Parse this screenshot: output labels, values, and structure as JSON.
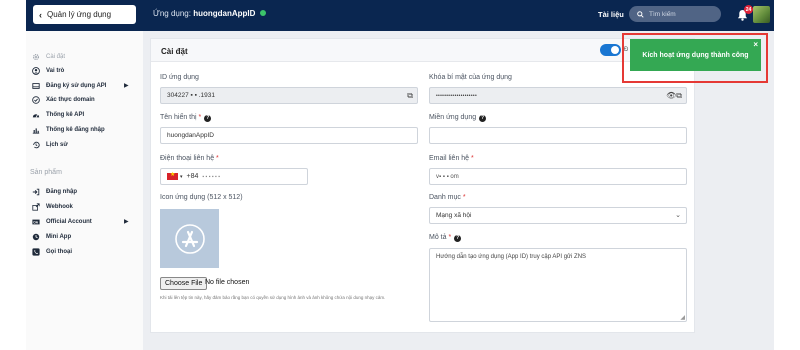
{
  "topbar": {
    "back_label": "Quản lý ứng dụng",
    "app_prefix": "Ứng dụng:",
    "app_name": "huongdanAppID",
    "docs_label": "Tài liệu",
    "search_placeholder": "Tìm kiếm",
    "notification_count": "24"
  },
  "sidebar": {
    "items": [
      {
        "label": "Cài đặt",
        "icon": "gear-icon"
      },
      {
        "label": "Vai trò",
        "icon": "user-circle-icon"
      },
      {
        "label": "Đăng ký sử dụng API",
        "icon": "window-icon"
      },
      {
        "label": "Xác thực domain",
        "icon": "check-circle-icon"
      },
      {
        "label": "Thống kê API",
        "icon": "gauge-icon"
      },
      {
        "label": "Thống kê đăng nhập",
        "icon": "bar-chart-icon"
      },
      {
        "label": "Lịch sử",
        "icon": "history-icon"
      }
    ],
    "section_products": "Sản phẩm",
    "products": [
      {
        "label": "Đăng nhập",
        "icon": "login-icon"
      },
      {
        "label": "Webhook",
        "icon": "external-link-icon"
      },
      {
        "label": "Official Account",
        "icon": "oa-icon"
      },
      {
        "label": "Mini App",
        "icon": "mini-app-icon"
      },
      {
        "label": "Gọi thoại",
        "icon": "phone-icon"
      }
    ]
  },
  "settings": {
    "title": "Cài đặt",
    "toggle_label": "Đ",
    "app_id_label": "ID ứng dụng",
    "app_id_value": "304227   ▪   ▪  .1931",
    "secret_label": "Khóa bí mật của ứng dụng",
    "secret_value": "••••••••••••••••••••",
    "display_name_label": "Tên hiển thị",
    "display_name_value": "huongdanAppID",
    "domain_label": "Miền ứng dụng",
    "domain_value": "",
    "phone_label": "Điện thoại liên hệ",
    "phone_code": "+84",
    "phone_value": "▪ ▪ ▪ ▪ ▪ ▪",
    "email_label": "Email liên hệ",
    "email_value": "v▪  ▪   ▪  om",
    "icon_label": "Icon ứng dụng (512 x 512)",
    "choose_file": "Choose File",
    "no_file": "No file chosen",
    "upload_hint": "Khi tải lên tệp tin này, hãy đảm bảo rằng bạn có quyền sử dụng hình ảnh và ảnh không chứa nội dung nhạy cảm.",
    "category_label": "Danh mục",
    "category_value": "Mạng xã hội",
    "description_label": "Mô tả",
    "description_value": "Hướng dẫn tạo ứng dụng (App ID) truy cập API gửi ZNS"
  },
  "toast": {
    "message": "Kích hoạt ứng dụng thành công",
    "close": "×"
  },
  "colors": {
    "topbar": "#0a2650",
    "toast": "#34a853",
    "highlight": "#e53935",
    "toggle": "#1976d2"
  }
}
